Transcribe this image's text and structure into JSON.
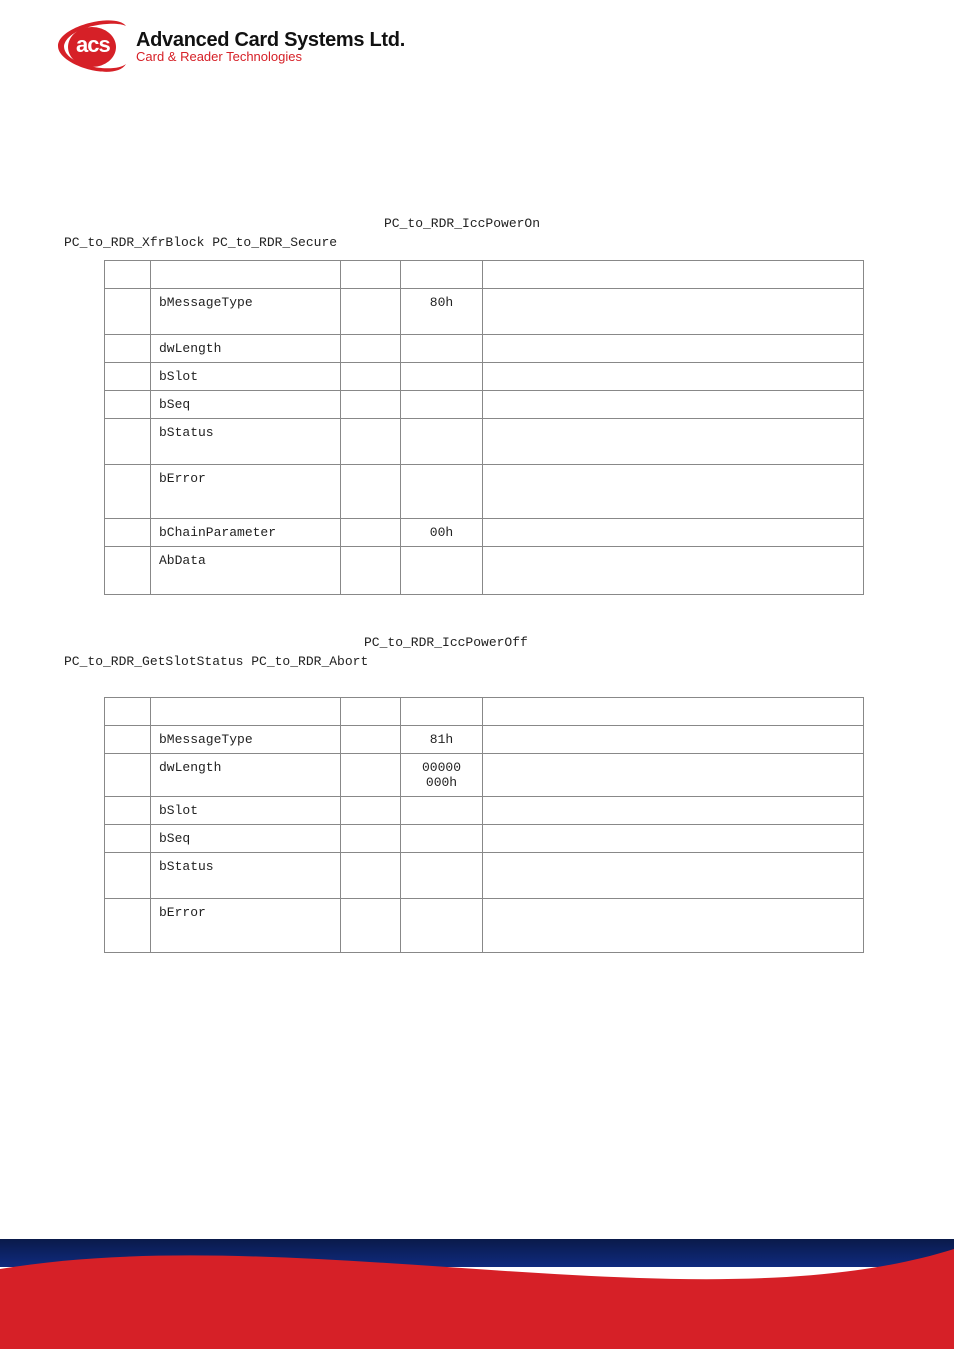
{
  "brand": {
    "logo_text": "acs",
    "title": "Advanced Card Systems Ltd.",
    "subtitle": "Card & Reader Technologies"
  },
  "section1": {
    "cmd_right": "PC_to_RDR_IccPowerOn",
    "cmd_left": "PC_to_RDR_XfrBlock    PC_to_RDR_Secure"
  },
  "table1": {
    "rows": [
      {
        "field": "bMessageType",
        "value": "80h"
      },
      {
        "field": "dwLength",
        "value": ""
      },
      {
        "field": "bSlot",
        "value": ""
      },
      {
        "field": "bSeq",
        "value": ""
      },
      {
        "field": "bStatus",
        "value": ""
      },
      {
        "field": "bError",
        "value": ""
      },
      {
        "field": "bChainParameter",
        "value": "00h"
      },
      {
        "field": "AbData",
        "value": ""
      }
    ]
  },
  "section2": {
    "cmd_right": "PC_to_RDR_IccPowerOff",
    "cmd_left": "PC_to_RDR_GetSlotStatus PC_to_RDR_Abort"
  },
  "table2": {
    "rows": [
      {
        "field": "bMessageType",
        "value": "81h"
      },
      {
        "field": "dwLength",
        "value": "00000000h"
      },
      {
        "field": "bSlot",
        "value": ""
      },
      {
        "field": "bSeq",
        "value": ""
      },
      {
        "field": "bStatus",
        "value": ""
      },
      {
        "field": "bError",
        "value": ""
      }
    ]
  }
}
